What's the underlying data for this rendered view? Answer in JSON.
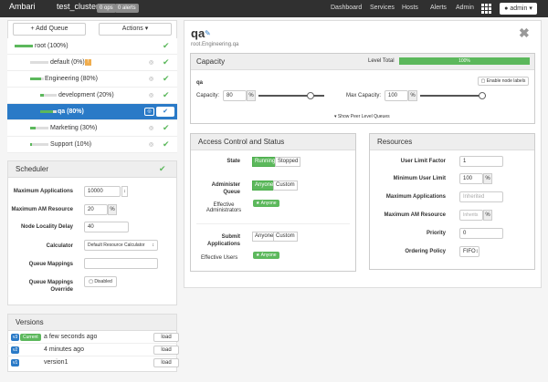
{
  "topbar": {
    "brand": "Ambari",
    "cluster": "test_cluster",
    "ops_badge": "0 ops",
    "alerts_badge": "0 alerts",
    "nav": [
      "Dashboard",
      "Services",
      "Hosts",
      "Alerts",
      "Admin"
    ],
    "user": "admin"
  },
  "tree": {
    "add_queue": "+ Add Queue",
    "actions": "Actions",
    "queues": [
      {
        "label": "root (100%)",
        "fill": 1.0
      },
      {
        "label": "default (0%)",
        "fill": 0.0
      },
      {
        "label": "Engineering (80%)",
        "fill": 0.8
      },
      {
        "label": "development (20%)",
        "fill": 0.2
      },
      {
        "label": "qa (80%)",
        "fill": 0.8
      },
      {
        "label": "Marketing (30%)",
        "fill": 0.3
      },
      {
        "label": "Support (10%)",
        "fill": 0.1
      }
    ]
  },
  "scheduler": {
    "title": "Scheduler",
    "fields": [
      {
        "label": "Maximum Applications",
        "value": "10000"
      },
      {
        "label": "Maximum AM Resource",
        "value": "20",
        "unit": "%"
      },
      {
        "label": "Node Locality Delay",
        "value": "40"
      },
      {
        "label": "Calculator",
        "value": "Default Resource Calculator"
      },
      {
        "label": "Queue Mappings",
        "value": ""
      },
      {
        "label": "Queue Mappings Override",
        "value": "Disabled"
      }
    ]
  },
  "versions": {
    "title": "Versions",
    "rows": [
      {
        "tag": "v3",
        "current": "Current",
        "time": "a few seconds ago",
        "action": "load"
      },
      {
        "tag": "v2",
        "time": "4 minutes ago",
        "action": "load"
      },
      {
        "tag": "v1",
        "time": "version1",
        "action": "load"
      }
    ]
  },
  "queue": {
    "name": "qa",
    "path": "root.Engineering.qa"
  },
  "capacity": {
    "title": "Capacity",
    "level_total_label": "Level Total",
    "level_total": "100%",
    "level_total_fill": 1.0,
    "queue_label": "qa",
    "enable_node_labels": "Enable node labels",
    "capacity_label": "Capacity:",
    "capacity_value": "80",
    "max_capacity_label": "Max Capacity:",
    "max_capacity_value": "100",
    "unit": "%",
    "show_peer": "Show Peer Level Queues",
    "capacity_level": 0.8,
    "max_capacity_level": 1.0
  },
  "access": {
    "title": "Access Control and Status",
    "state_label": "State",
    "running": "Running",
    "stopped": "Stopped",
    "admin_label": "Administer Queue",
    "anyone": "Anyone",
    "custom": "Custom",
    "eff_admin_label": "Effective Administrators",
    "anyone_tag": "Anyone",
    "submit_label": "Submit Applications",
    "eff_users_label": "Effective Users"
  },
  "resources": {
    "title": "Resources",
    "fields": [
      {
        "label": "User Limit Factor",
        "value": "1"
      },
      {
        "label": "Minimum User Limit",
        "value": "100",
        "unit": "%"
      },
      {
        "label": "Maximum Applications",
        "placeholder": "Inherited"
      },
      {
        "label": "Maximum AM Resource",
        "placeholder": "Inherits",
        "unit": "%"
      },
      {
        "label": "Priority",
        "value": "0"
      },
      {
        "label": "Ordering Policy",
        "value": "FIFO"
      }
    ]
  },
  "colors": {
    "accent": "#2a7ac7",
    "success": "#5cb85c",
    "topbar": "#303030"
  }
}
